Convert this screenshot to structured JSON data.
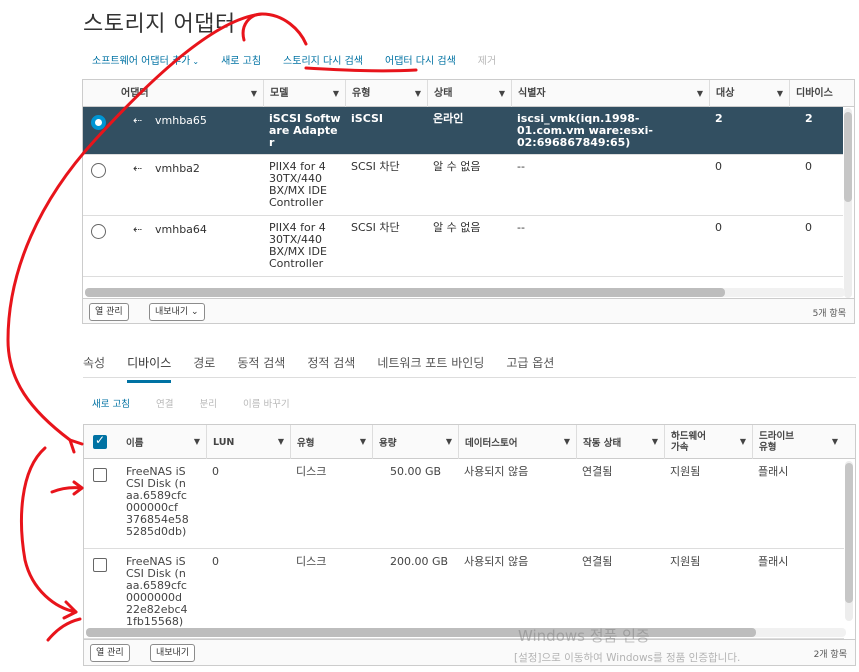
{
  "title": "스토리지 어댑터",
  "toolbar": {
    "add_software_adapter": "소프트웨어 어댑터 추가",
    "refresh": "새로 고침",
    "rescan_storage": "스토리지 다시 검색",
    "rescan_adapter": "어댑터 다시 검색",
    "remove": "제거"
  },
  "adapters_table": {
    "columns": [
      "어댑터",
      "모델",
      "유형",
      "상태",
      "식별자",
      "대상",
      "디바이스"
    ],
    "rows": [
      {
        "adapter": "vmhba65",
        "model": "iSCSI Softw are Adapte r",
        "type": "iSCSI",
        "status": "온라인",
        "identifier": "iscsi_vmk(iqn.1998-01.com.vm ware:esxi-02:696867849:65)",
        "targets": "2",
        "devices": "2",
        "selected": true
      },
      {
        "adapter": "vmhba2",
        "model": "PIIX4 for 4 30TX/440 BX/MX IDE Controller",
        "type": "SCSI 차단",
        "status": "알 수 없음",
        "identifier": "--",
        "targets": "0",
        "devices": "0",
        "selected": false
      },
      {
        "adapter": "vmhba64",
        "model": "PIIX4 for 4 30TX/440 BX/MX IDE Controller",
        "type": "SCSI 차단",
        "status": "알 수 없음",
        "identifier": "--",
        "targets": "0",
        "devices": "0",
        "selected": false
      }
    ],
    "footer": {
      "manage_columns": "열 관리",
      "export": "내보내기",
      "count": "5개 항목"
    }
  },
  "tabs": [
    "속성",
    "디바이스",
    "경로",
    "동적 검색",
    "정적 검색",
    "네트워크 포트 바인딩",
    "고급 옵션"
  ],
  "active_tab": "디바이스",
  "device_toolbar": {
    "refresh": "새로 고침",
    "attach": "연결",
    "detach": "분리",
    "rename": "이름 바꾸기"
  },
  "devices_table": {
    "columns": [
      "이름",
      "LUN",
      "유형",
      "용량",
      "데이터스토어",
      "작동 상태",
      "하드웨어 가속",
      "드라이브 유형"
    ],
    "rows": [
      {
        "name": "FreeNAS iS CSI Disk (n aa.6589cfc 000000cf 376854e58 5285d0db)",
        "lun": "0",
        "type": "디스크",
        "capacity": "50.00 GB",
        "datastore": "사용되지 않음",
        "op_state": "연결됨",
        "hw_accel": "지원됨",
        "drive_type": "플래시"
      },
      {
        "name": "FreeNAS iS CSI Disk (n aa.6589cfc 0000000d 22e82ebc4 1fb15568)",
        "lun": "0",
        "type": "디스크",
        "capacity": "200.00 GB",
        "datastore": "사용되지 않음",
        "op_state": "연결됨",
        "hw_accel": "지원됨",
        "drive_type": "플래시"
      }
    ],
    "footer": {
      "manage_columns": "열 관리",
      "export": "내보내기",
      "count": "2개 항목"
    }
  },
  "watermark": {
    "line1": "Windows 정품 인증",
    "line2": "[설정]으로 이동하여 Windows를 정품 인증합니다."
  },
  "colors": {
    "accent": "#0072a3",
    "selected_row": "#324f61",
    "annotation": "#e8141b"
  }
}
